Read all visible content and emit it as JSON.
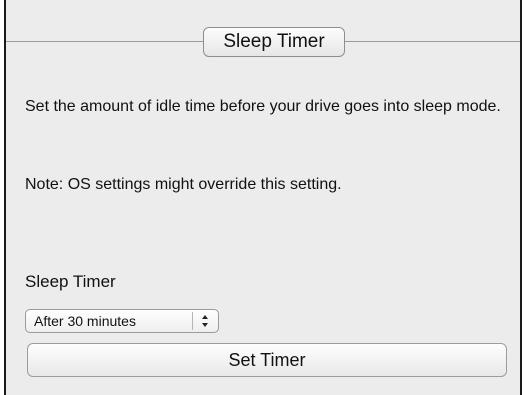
{
  "section": {
    "title": "Sleep Timer"
  },
  "content": {
    "description": "Set the amount of idle time before your drive goes into sleep mode.",
    "note": "Note: OS settings might override this setting."
  },
  "form": {
    "label": "Sleep Timer",
    "select_value": "After 30 minutes",
    "submit_label": "Set Timer"
  }
}
